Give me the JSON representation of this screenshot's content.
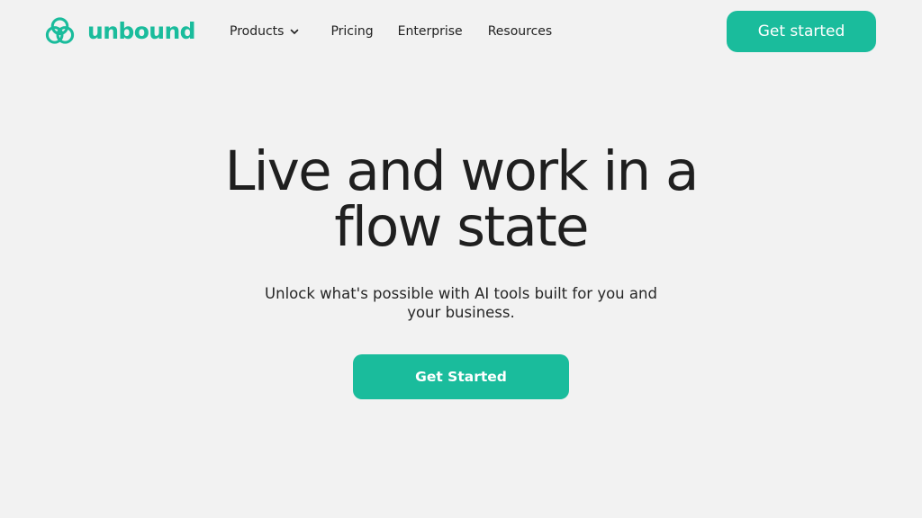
{
  "brand": {
    "name": "unbound",
    "logo_icon": "three-loop-knot-icon",
    "color": "#1abc9c"
  },
  "nav": {
    "items": [
      {
        "label": "Products",
        "has_dropdown": true,
        "icon": "chevron-down-icon"
      },
      {
        "label": "Pricing"
      },
      {
        "label": "Enterprise"
      },
      {
        "label": "Resources"
      }
    ],
    "cta_label": "Get started"
  },
  "hero": {
    "title": "Live and work in a flow state",
    "subtitle": "Unlock what's possible with AI tools built for you and your business.",
    "cta_label": "Get Started"
  },
  "colors": {
    "background": "#f2f2f2",
    "accent": "#1abc9c",
    "text": "#212121"
  }
}
